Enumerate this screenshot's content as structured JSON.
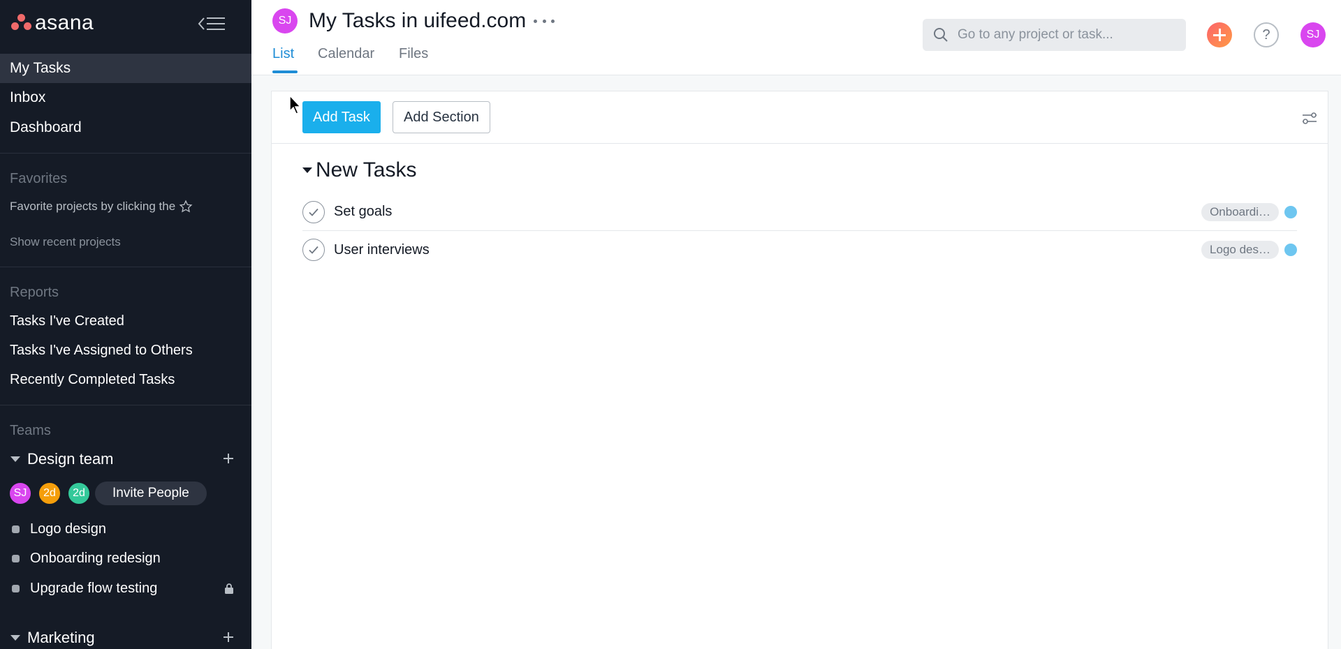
{
  "brand": {
    "name": "asana",
    "accent": "#1aafec",
    "logo_color": "#f06a6a"
  },
  "sidebar": {
    "nav": [
      {
        "label": "My Tasks",
        "active": true
      },
      {
        "label": "Inbox",
        "active": false
      },
      {
        "label": "Dashboard",
        "active": false
      }
    ],
    "favorites": {
      "title": "Favorites",
      "hint": "Favorite projects by clicking the",
      "hint_icon": "star-icon",
      "show_recent": "Show recent projects"
    },
    "reports": {
      "title": "Reports",
      "items": [
        "Tasks I've Created",
        "Tasks I've Assigned to Others",
        "Recently Completed Tasks"
      ]
    },
    "teams": {
      "title": "Teams",
      "list": [
        {
          "name": "Design team",
          "members": [
            {
              "initials": "SJ",
              "color": "#d946ef"
            },
            {
              "initials": "2d",
              "color": "#f59e0b"
            },
            {
              "initials": "2d",
              "color": "#34c99a"
            }
          ],
          "invite_label": "Invite People",
          "projects": [
            {
              "name": "Logo design",
              "locked": false
            },
            {
              "name": "Onboarding redesign",
              "locked": false
            },
            {
              "name": "Upgrade flow testing",
              "locked": true
            }
          ]
        },
        {
          "name": "Marketing"
        }
      ]
    }
  },
  "header": {
    "avatar_initials": "SJ",
    "title": "My Tasks in uifeed.com",
    "tabs": [
      {
        "label": "List",
        "active": true
      },
      {
        "label": "Calendar",
        "active": false
      },
      {
        "label": "Files",
        "active": false
      }
    ],
    "search_placeholder": "Go to any project or task...",
    "help_label": "?",
    "user_initials": "SJ"
  },
  "toolbar": {
    "add_task_label": "Add Task",
    "add_section_label": "Add Section"
  },
  "task_section": {
    "title": "New Tasks",
    "tasks": [
      {
        "name": "Set goals",
        "project_tag": "Onboardi…"
      },
      {
        "name": "User interviews",
        "project_tag": "Logo des…"
      }
    ]
  }
}
